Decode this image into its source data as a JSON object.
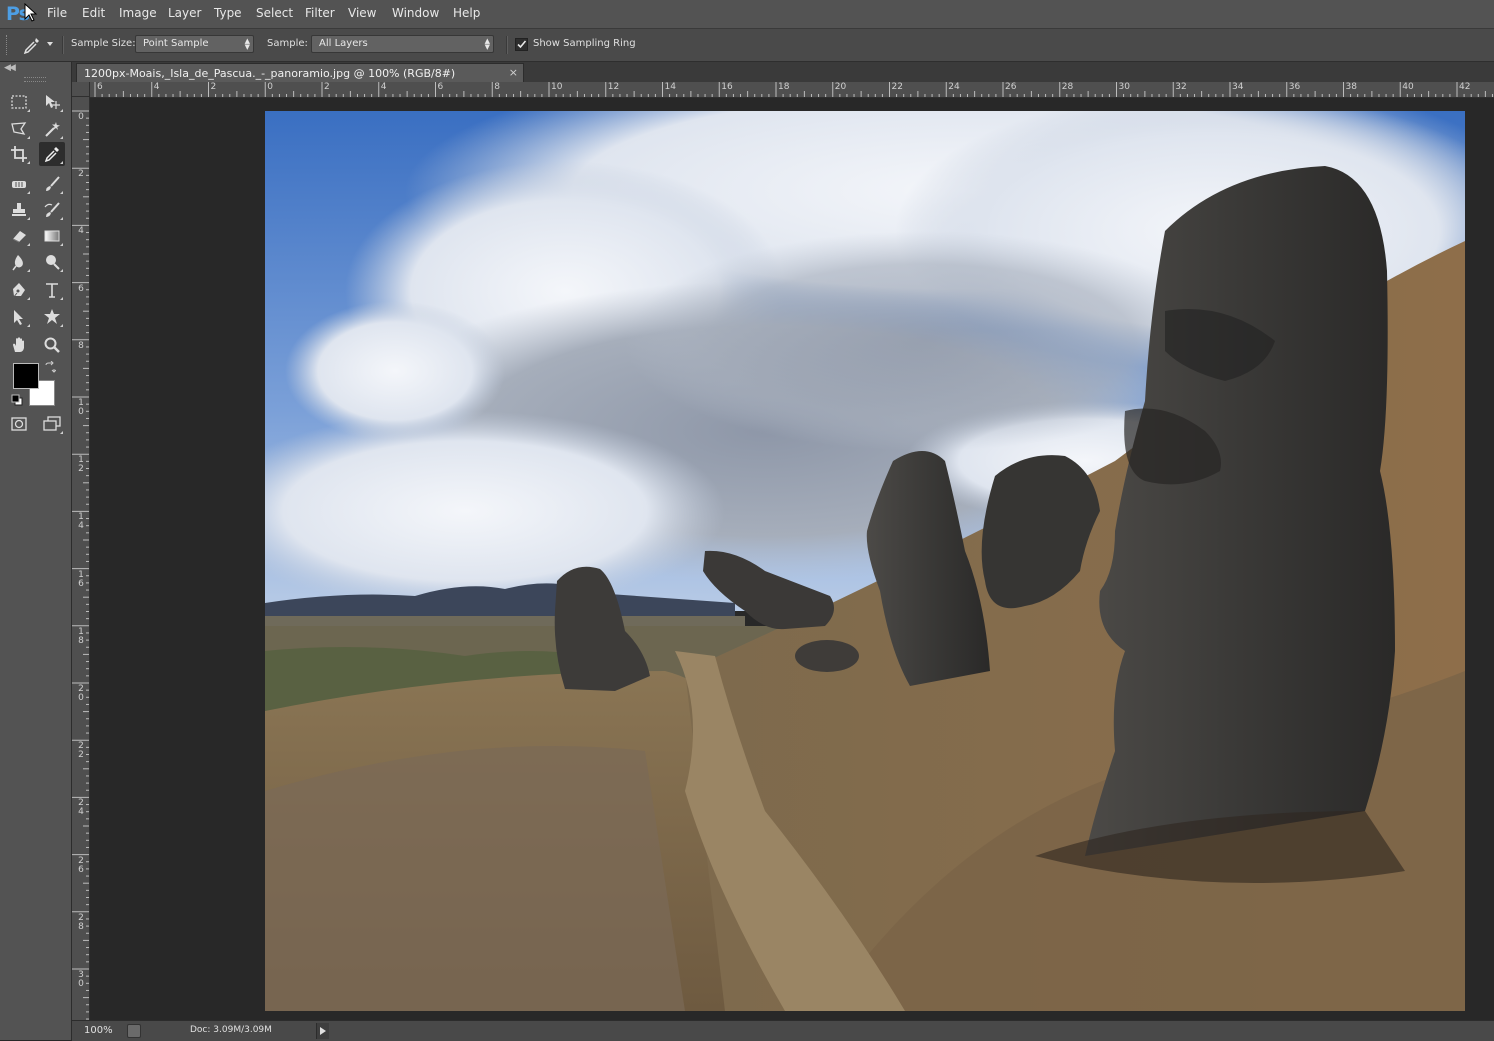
{
  "app": {
    "logo": "Ps"
  },
  "menu": [
    "File",
    "Edit",
    "Image",
    "Layer",
    "Type",
    "Select",
    "Filter",
    "View",
    "Window",
    "Help"
  ],
  "options": {
    "sample_size_label": "Sample Size:",
    "sample_size_value": "Point Sample",
    "sample_label": "Sample:",
    "sample_value": "All Layers",
    "show_sampling_ring_label": "Show Sampling Ring",
    "show_sampling_ring_checked": true
  },
  "document": {
    "tab_title": "1200px-Moais,_Isla_de_Pascua._-_panoramio.jpg @ 100% (RGB/8#)",
    "close": "×"
  },
  "rulers": {
    "horizontal": [
      "6",
      "4",
      "2",
      "0",
      "2",
      "4",
      "6",
      "8",
      "10",
      "12",
      "14",
      "16",
      "18",
      "20",
      "22",
      "24",
      "26",
      "28",
      "30",
      "32",
      "34",
      "36",
      "38",
      "40",
      "42"
    ],
    "vertical": [
      "0",
      "2",
      "4",
      "6",
      "8",
      "1 0",
      "1 2",
      "1 4",
      "1 6",
      "1 8",
      "2 0",
      "2 2",
      "2 4",
      "2 6",
      "2 8",
      "3 0"
    ]
  },
  "status": {
    "zoom": "100%",
    "doc_info": "Doc: 3.09M/3.09M"
  },
  "tools": [
    "rectangular-marquee-icon",
    "move-icon",
    "polygonal-lasso-icon",
    "magic-wand-icon",
    "crop-icon",
    "eyedropper-icon",
    "spot-healing-icon",
    "brush-icon",
    "clone-stamp-icon",
    "history-brush-icon",
    "eraser-icon",
    "gradient-icon",
    "blur-icon",
    "dodge-icon",
    "pen-icon",
    "type-icon",
    "path-selection-icon",
    "custom-shape-icon",
    "hand-icon",
    "zoom-icon"
  ],
  "colors": {
    "foreground": "#000000",
    "background": "#ffffff",
    "ps_blue": "#4d9ee4"
  }
}
